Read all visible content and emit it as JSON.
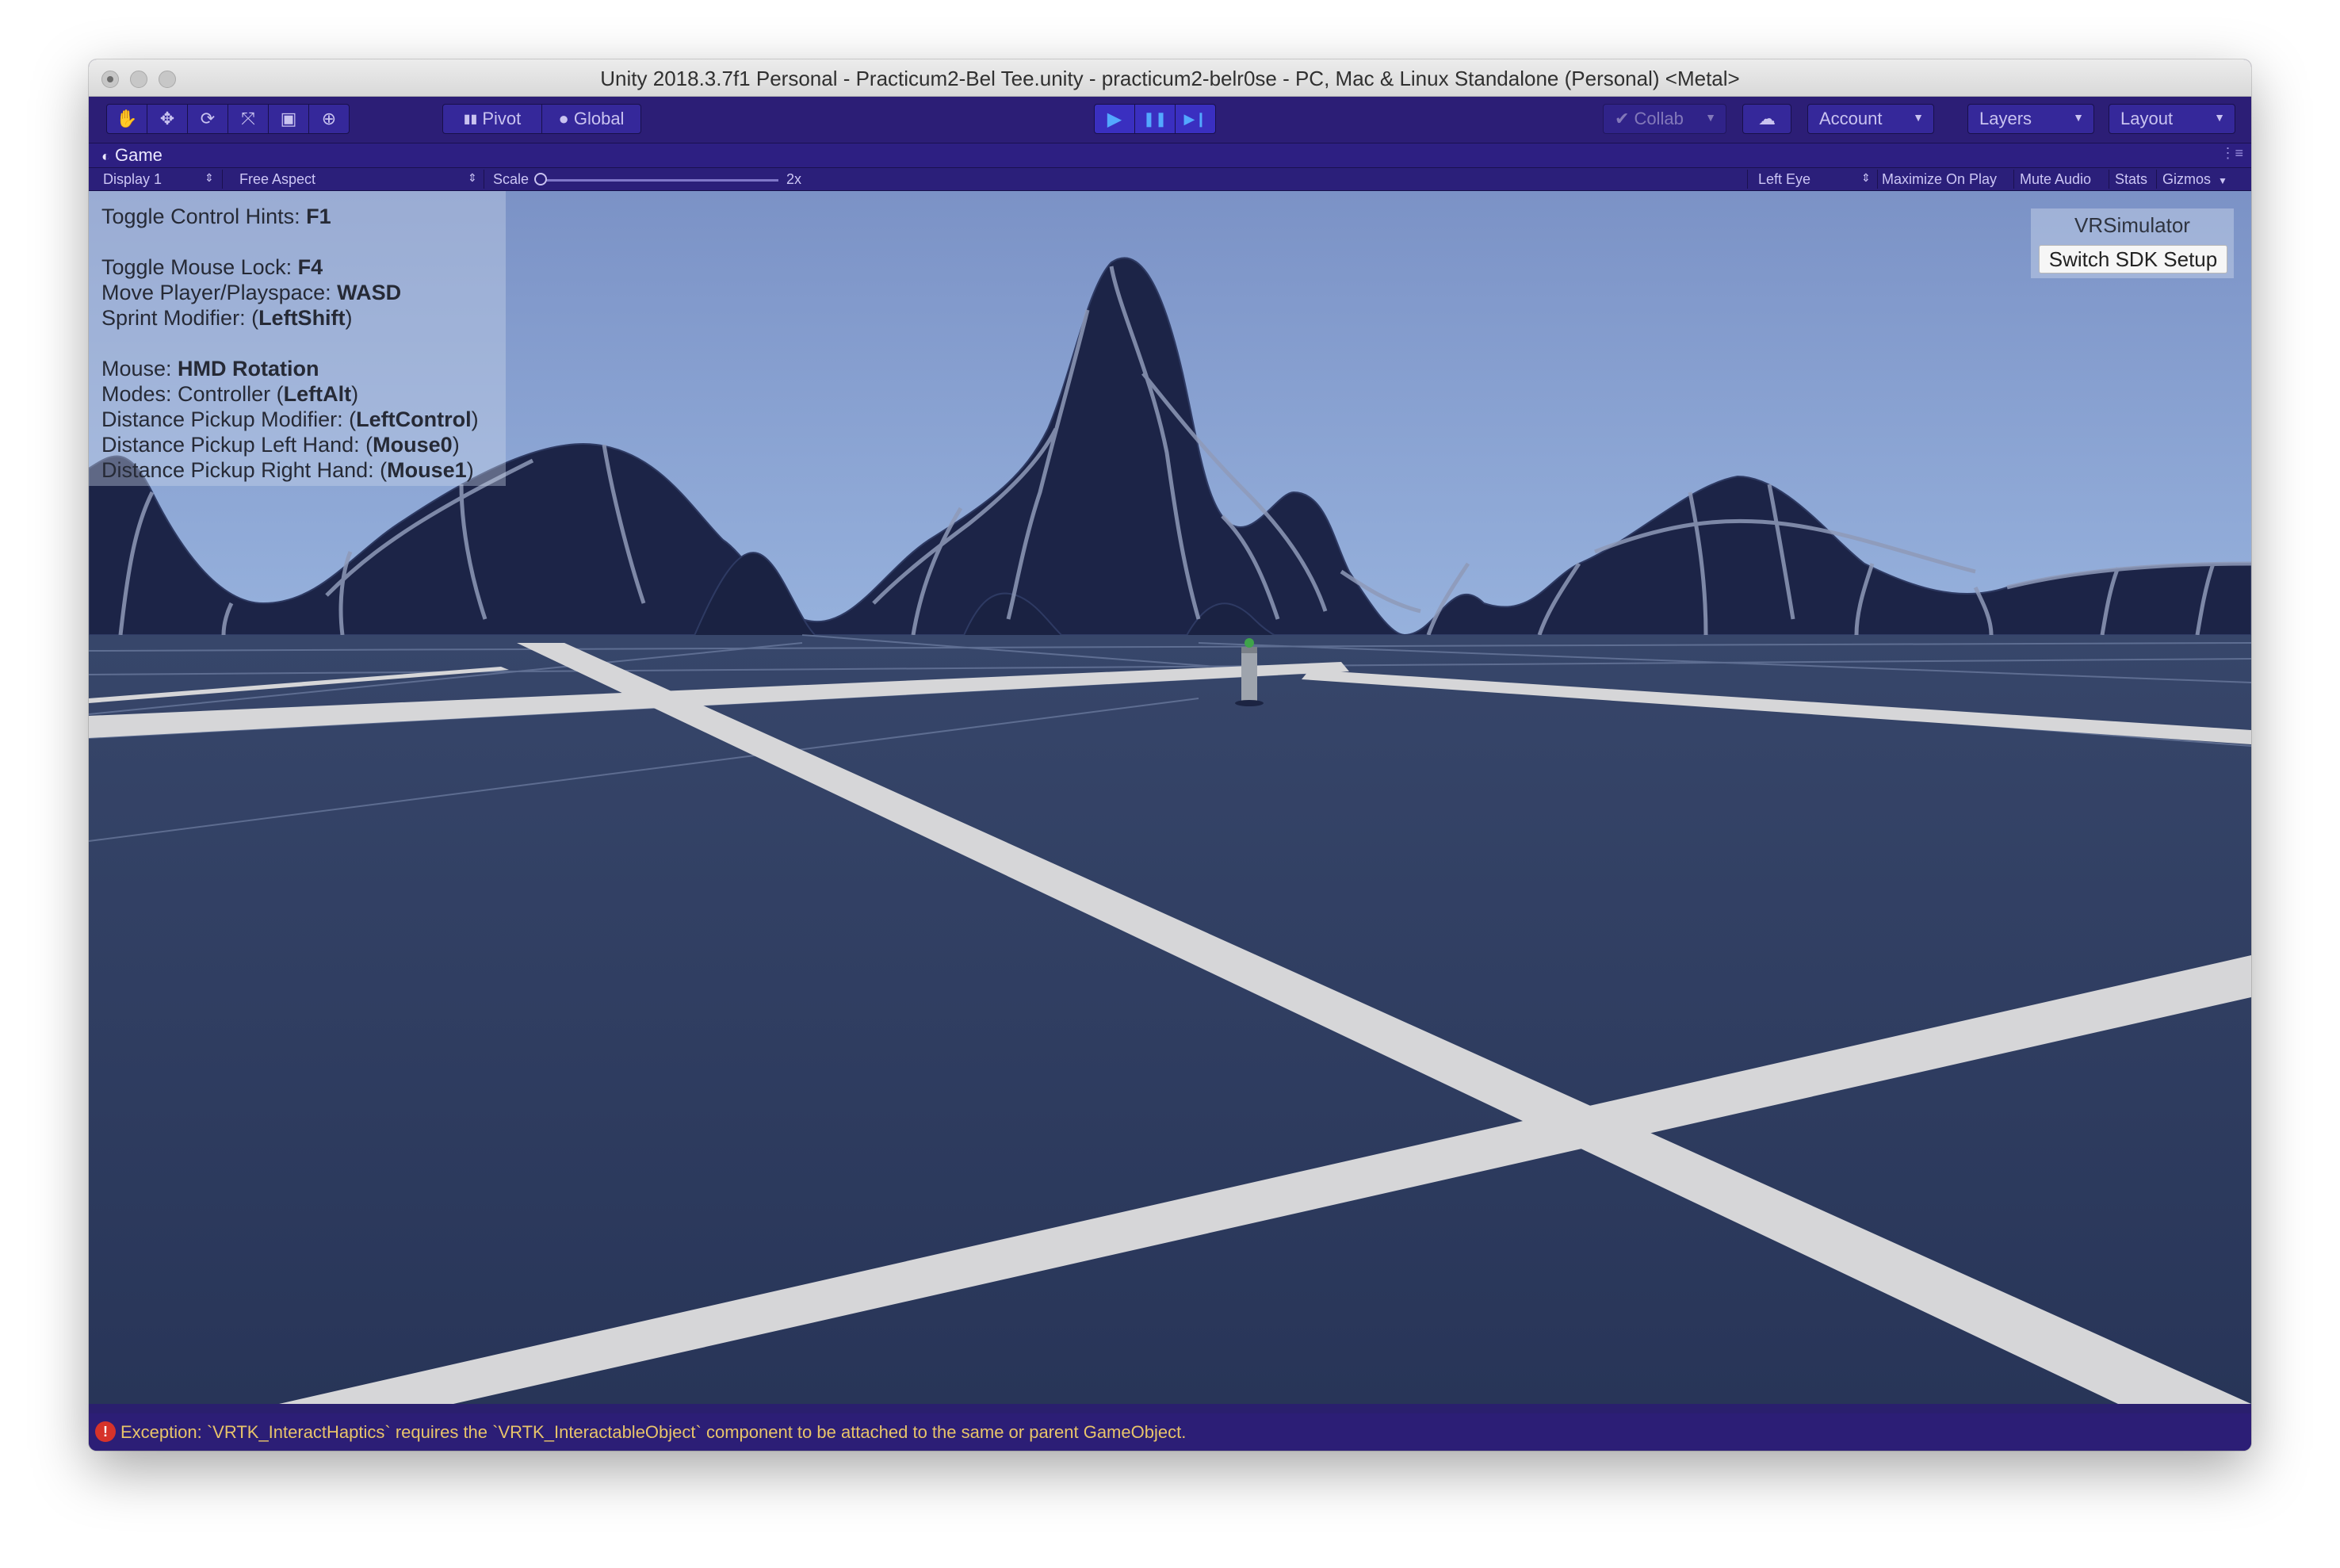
{
  "window": {
    "title": "Unity 2018.3.7f1 Personal - Practicum2-Bel Tee.unity - practicum2-belr0se - PC, Mac & Linux Standalone (Personal) <Metal>"
  },
  "toolbar": {
    "tools": [
      {
        "name": "hand-tool",
        "glyph": "✋"
      },
      {
        "name": "move-tool",
        "glyph": "✥"
      },
      {
        "name": "rotate-tool",
        "glyph": "⟳"
      },
      {
        "name": "scale-tool",
        "glyph": "⤧"
      },
      {
        "name": "rect-tool",
        "glyph": "▣"
      },
      {
        "name": "transform-tool",
        "glyph": "⊕"
      }
    ],
    "pivot_label": "Pivot",
    "global_label": "Global",
    "play_glyph": "▶",
    "pause_glyph": "❚❚",
    "step_glyph": "▶❙",
    "collab_label": "Collab",
    "account_label": "Account",
    "layers_label": "Layers",
    "layout_label": "Layout"
  },
  "game_tab": {
    "label": "Game",
    "display": "Display 1",
    "aspect": "Free Aspect",
    "scale_label": "Scale",
    "scale_value": "2x",
    "eye": "Left Eye",
    "maximize_on_play": "Maximize On Play",
    "mute_audio": "Mute Audio",
    "stats": "Stats",
    "gizmos": "Gizmos"
  },
  "hints": {
    "toggle_hints": {
      "label": "Toggle Control Hints: ",
      "key": "F1"
    },
    "mouse_lock": {
      "label": "Toggle Mouse Lock: ",
      "key": "F4"
    },
    "move": {
      "label": "Move Player/Playspace: ",
      "key": "WASD"
    },
    "sprint": {
      "label": "Sprint Modifier: (",
      "key": "LeftShift",
      "suffix": ")"
    },
    "mouse": {
      "label": "Mouse: ",
      "key": "HMD Rotation"
    },
    "modes": {
      "label": "Modes: Controller (",
      "key": "LeftAlt",
      "suffix": ")"
    },
    "pickup_modifier": {
      "label": "Distance Pickup Modifier: (",
      "key": "LeftControl",
      "suffix": ")"
    },
    "pickup_left": {
      "label": "Distance Pickup Left Hand: (",
      "key": "Mouse0",
      "suffix": ")"
    },
    "pickup_right": {
      "label": "Distance Pickup Right Hand: (",
      "key": "Mouse1",
      "suffix": ")"
    }
  },
  "vr_simulator": {
    "label": "VRSimulator",
    "button": "Switch SDK Setup"
  },
  "console": {
    "message": "Exception: `VRTK_InteractHaptics` requires the `VRTK_InteractableObject` component to be attached to the same or parent GameObject."
  },
  "colors": {
    "editor_accent": "#2c1e76",
    "sky_top": "#7f96c8",
    "sky_bottom": "#bcd8f0",
    "ground": "#2c3a5c",
    "mountains": "#1c2447",
    "error": "#d6332a"
  }
}
